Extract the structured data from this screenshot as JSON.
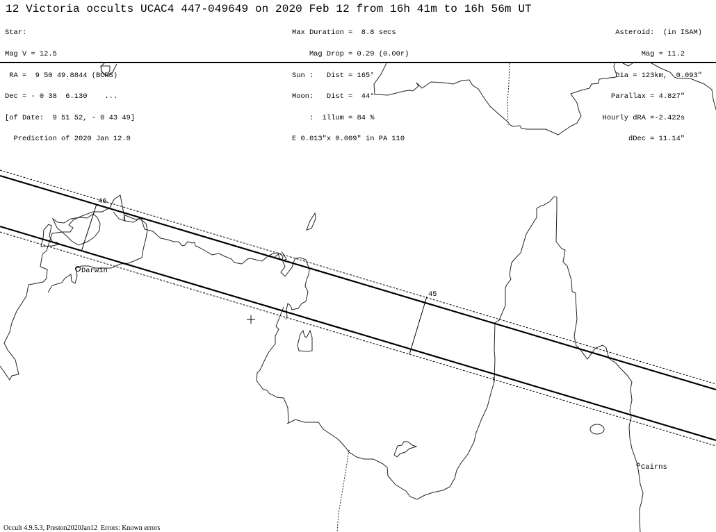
{
  "header": {
    "title": "12 Victoria occults UCAC4 447-049649 on 2020 Feb 12 from 16h 41m to 16h 56m UT",
    "star": [
      "Star:",
      "Mag V = 12.5",
      " RA =  9 50 49.8844 (BCRS)",
      "Dec = - 0 38  6.130    ...",
      "[of Date:  9 51 52, - 0 43 49]",
      "  Prediction of 2020 Jan 12.0"
    ],
    "event": [
      "Max Duration =  8.8 secs",
      "    Mag Drop = 0.29 (0.00r)",
      "Sun :   Dist = 165°",
      "Moon:   Dist =  44°",
      "    :  illum = 84 %",
      "E 0.013\"x 0.009\" in PA 110"
    ],
    "asteroid": [
      "Asteroid:  (in ISAM)",
      "Mag = 11.2    ",
      "Dia = 123km,  0.093\"",
      "Parallax = 4.827\"    ",
      "Hourly dRA =-2.422s    ",
      "dDec = 11.14\"    "
    ]
  },
  "map": {
    "time_markers": [
      {
        "label": "46"
      },
      {
        "label": "45"
      }
    ],
    "places": [
      {
        "name": "Darwin"
      },
      {
        "name": "Cairns"
      }
    ],
    "center_marker": "plus-marker"
  },
  "footer": {
    "text": "Occult 4.9.5.3, Preston2020Jan12  Errors: Known errors"
  }
}
